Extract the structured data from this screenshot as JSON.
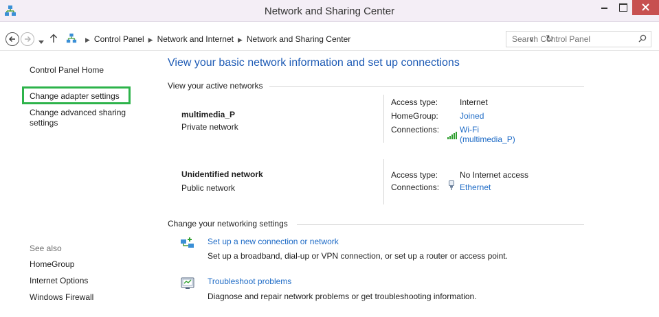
{
  "window": {
    "title": "Network and Sharing Center",
    "close_color": "#c75050"
  },
  "address": {
    "breadcrumbs": [
      "Control Panel",
      "Network and Internet",
      "Network and Sharing Center"
    ],
    "search_placeholder": "Search Control Panel"
  },
  "sidebar": {
    "home": "Control Panel Home",
    "adapter": "Change adapter settings",
    "advanced": "Change advanced sharing settings",
    "highlight_color": "#2db34a",
    "see_also_label": "See also",
    "see_also": [
      "HomeGroup",
      "Internet Options",
      "Windows Firewall"
    ]
  },
  "main": {
    "title": "View your basic network information and set up connections",
    "active_networks_heading": "View your active networks",
    "networks": [
      {
        "name": "multimedia_P",
        "type": "Private network",
        "access_label": "Access type:",
        "access_value": "Internet",
        "homegroup_label": "HomeGroup:",
        "homegroup_value": "Joined",
        "connections_label": "Connections:",
        "connection_line1": "Wi-Fi",
        "connection_line2": "(multimedia_P)",
        "connection_icon": "wifi-signal-icon"
      },
      {
        "name": "Unidentified network",
        "type": "Public network",
        "access_label": "Access type:",
        "access_value": "No Internet access",
        "connections_label": "Connections:",
        "connection_line1": "Ethernet",
        "connection_icon": "ethernet-icon"
      }
    ],
    "settings_heading": "Change your networking settings",
    "tasks": [
      {
        "link": "Set up a new connection or network",
        "desc": "Set up a broadband, dial-up or VPN connection, or set up a router or access point.",
        "icon": "new-connection-icon"
      },
      {
        "link": "Troubleshoot problems",
        "desc": "Diagnose and repair network problems or get troubleshooting information.",
        "icon": "troubleshoot-icon"
      }
    ],
    "link_color": "#1e6bc6"
  }
}
